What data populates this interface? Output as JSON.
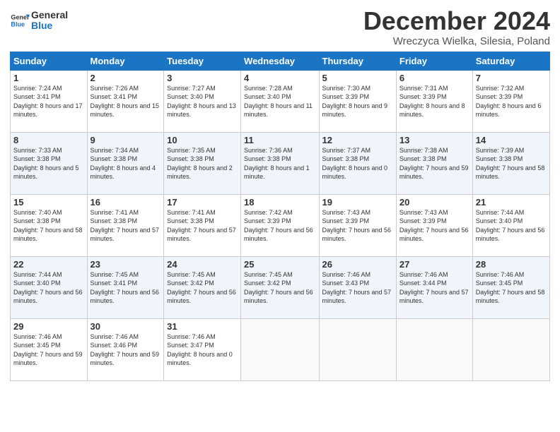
{
  "logo": {
    "line1": "General",
    "line2": "Blue"
  },
  "header": {
    "month": "December 2024",
    "location": "Wreczyca Wielka, Silesia, Poland"
  },
  "weekdays": [
    "Sunday",
    "Monday",
    "Tuesday",
    "Wednesday",
    "Thursday",
    "Friday",
    "Saturday"
  ],
  "weeks": [
    [
      {
        "day": "1",
        "sunrise": "7:24 AM",
        "sunset": "3:41 PM",
        "daylight": "8 hours and 17 minutes."
      },
      {
        "day": "2",
        "sunrise": "7:26 AM",
        "sunset": "3:41 PM",
        "daylight": "8 hours and 15 minutes."
      },
      {
        "day": "3",
        "sunrise": "7:27 AM",
        "sunset": "3:40 PM",
        "daylight": "8 hours and 13 minutes."
      },
      {
        "day": "4",
        "sunrise": "7:28 AM",
        "sunset": "3:40 PM",
        "daylight": "8 hours and 11 minutes."
      },
      {
        "day": "5",
        "sunrise": "7:30 AM",
        "sunset": "3:39 PM",
        "daylight": "8 hours and 9 minutes."
      },
      {
        "day": "6",
        "sunrise": "7:31 AM",
        "sunset": "3:39 PM",
        "daylight": "8 hours and 8 minutes."
      },
      {
        "day": "7",
        "sunrise": "7:32 AM",
        "sunset": "3:39 PM",
        "daylight": "8 hours and 6 minutes."
      }
    ],
    [
      {
        "day": "8",
        "sunrise": "7:33 AM",
        "sunset": "3:38 PM",
        "daylight": "8 hours and 5 minutes."
      },
      {
        "day": "9",
        "sunrise": "7:34 AM",
        "sunset": "3:38 PM",
        "daylight": "8 hours and 4 minutes."
      },
      {
        "day": "10",
        "sunrise": "7:35 AM",
        "sunset": "3:38 PM",
        "daylight": "8 hours and 2 minutes."
      },
      {
        "day": "11",
        "sunrise": "7:36 AM",
        "sunset": "3:38 PM",
        "daylight": "8 hours and 1 minute."
      },
      {
        "day": "12",
        "sunrise": "7:37 AM",
        "sunset": "3:38 PM",
        "daylight": "8 hours and 0 minutes."
      },
      {
        "day": "13",
        "sunrise": "7:38 AM",
        "sunset": "3:38 PM",
        "daylight": "7 hours and 59 minutes."
      },
      {
        "day": "14",
        "sunrise": "7:39 AM",
        "sunset": "3:38 PM",
        "daylight": "7 hours and 58 minutes."
      }
    ],
    [
      {
        "day": "15",
        "sunrise": "7:40 AM",
        "sunset": "3:38 PM",
        "daylight": "7 hours and 58 minutes."
      },
      {
        "day": "16",
        "sunrise": "7:41 AM",
        "sunset": "3:38 PM",
        "daylight": "7 hours and 57 minutes."
      },
      {
        "day": "17",
        "sunrise": "7:41 AM",
        "sunset": "3:38 PM",
        "daylight": "7 hours and 57 minutes."
      },
      {
        "day": "18",
        "sunrise": "7:42 AM",
        "sunset": "3:39 PM",
        "daylight": "7 hours and 56 minutes."
      },
      {
        "day": "19",
        "sunrise": "7:43 AM",
        "sunset": "3:39 PM",
        "daylight": "7 hours and 56 minutes."
      },
      {
        "day": "20",
        "sunrise": "7:43 AM",
        "sunset": "3:39 PM",
        "daylight": "7 hours and 56 minutes."
      },
      {
        "day": "21",
        "sunrise": "7:44 AM",
        "sunset": "3:40 PM",
        "daylight": "7 hours and 56 minutes."
      }
    ],
    [
      {
        "day": "22",
        "sunrise": "7:44 AM",
        "sunset": "3:40 PM",
        "daylight": "7 hours and 56 minutes."
      },
      {
        "day": "23",
        "sunrise": "7:45 AM",
        "sunset": "3:41 PM",
        "daylight": "7 hours and 56 minutes."
      },
      {
        "day": "24",
        "sunrise": "7:45 AM",
        "sunset": "3:42 PM",
        "daylight": "7 hours and 56 minutes."
      },
      {
        "day": "25",
        "sunrise": "7:45 AM",
        "sunset": "3:42 PM",
        "daylight": "7 hours and 56 minutes."
      },
      {
        "day": "26",
        "sunrise": "7:46 AM",
        "sunset": "3:43 PM",
        "daylight": "7 hours and 57 minutes."
      },
      {
        "day": "27",
        "sunrise": "7:46 AM",
        "sunset": "3:44 PM",
        "daylight": "7 hours and 57 minutes."
      },
      {
        "day": "28",
        "sunrise": "7:46 AM",
        "sunset": "3:45 PM",
        "daylight": "7 hours and 58 minutes."
      }
    ],
    [
      {
        "day": "29",
        "sunrise": "7:46 AM",
        "sunset": "3:45 PM",
        "daylight": "7 hours and 59 minutes."
      },
      {
        "day": "30",
        "sunrise": "7:46 AM",
        "sunset": "3:46 PM",
        "daylight": "7 hours and 59 minutes."
      },
      {
        "day": "31",
        "sunrise": "7:46 AM",
        "sunset": "3:47 PM",
        "daylight": "8 hours and 0 minutes."
      },
      null,
      null,
      null,
      null
    ]
  ],
  "labels": {
    "sunrise": "Sunrise:",
    "sunset": "Sunset:",
    "daylight": "Daylight:"
  }
}
